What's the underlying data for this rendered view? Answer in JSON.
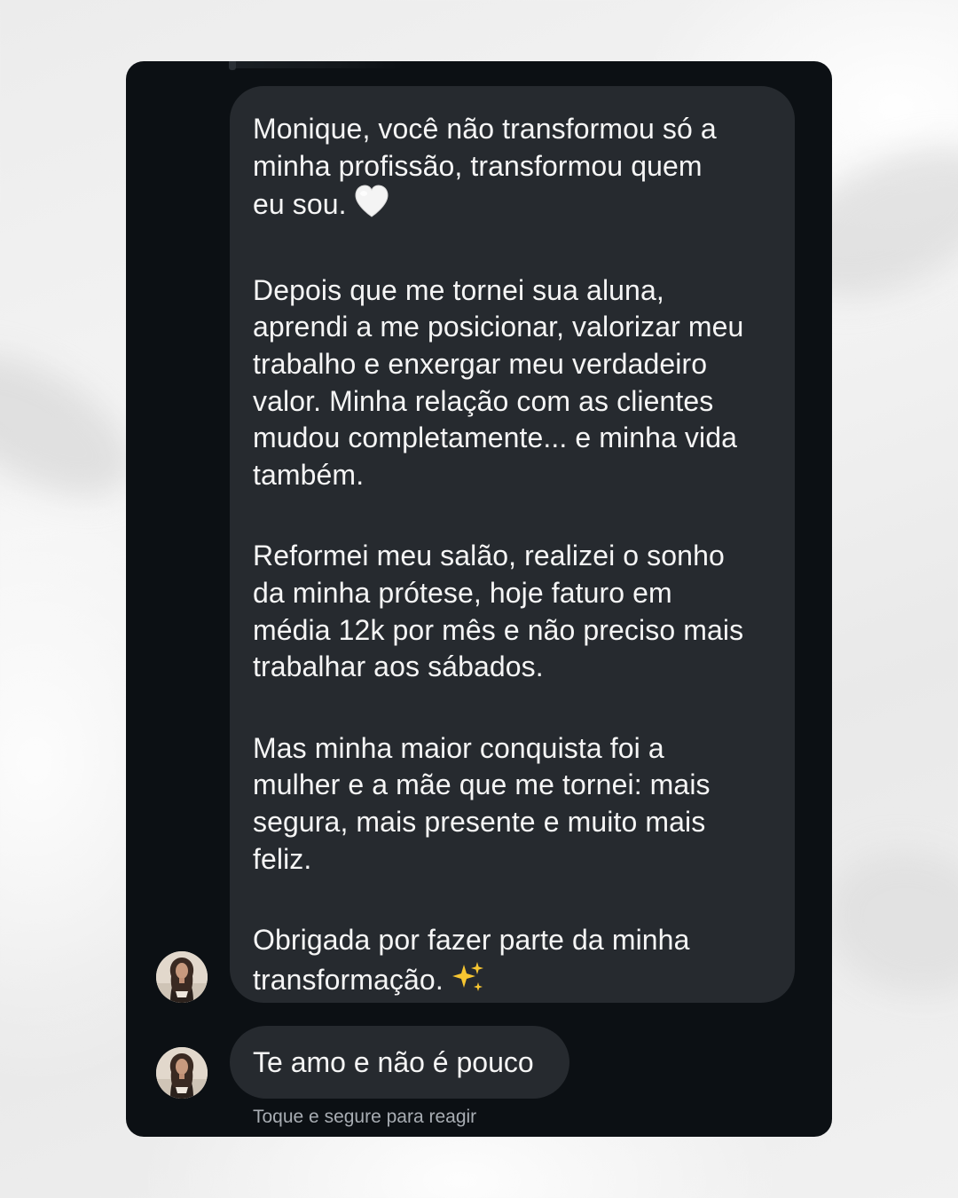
{
  "conversation": {
    "messages": [
      {
        "paragraphs": [
          "Monique, você não transformou só a\nminha profissão, transformou quem\neu sou.",
          "Depois que me tornei sua aluna,\naprendi a me posicionar, valorizar meu\ntrabalho e enxergar meu verdadeiro\nvalor. Minha relação com as clientes\nmudou completamente... e minha vida\ntambém.",
          "Reformei meu salão, realizei o sonho\nda minha prótese, hoje faturo em\nmédia 12k por mês e não preciso mais\ntrabalhar aos sábados.",
          "Mas minha maior conquista foi a\nmulher e a mãe que me tornei: mais\nsegura, mais presente e muito mais\nfeliz.",
          "Obrigada por fazer parte da minha\ntransformação."
        ],
        "emojis": [
          "white-heart-icon",
          "sparkles-icon"
        ]
      },
      {
        "text": "Te amo e não é pouco"
      }
    ],
    "reaction_hint": "Toque e segure para reagir"
  },
  "colors": {
    "panel_background": "#0c1014",
    "bubble_background": "#262a2f",
    "message_text": "#f5f5f5",
    "hint_text": "#a8adb3",
    "page_background": "#eeeeee"
  }
}
